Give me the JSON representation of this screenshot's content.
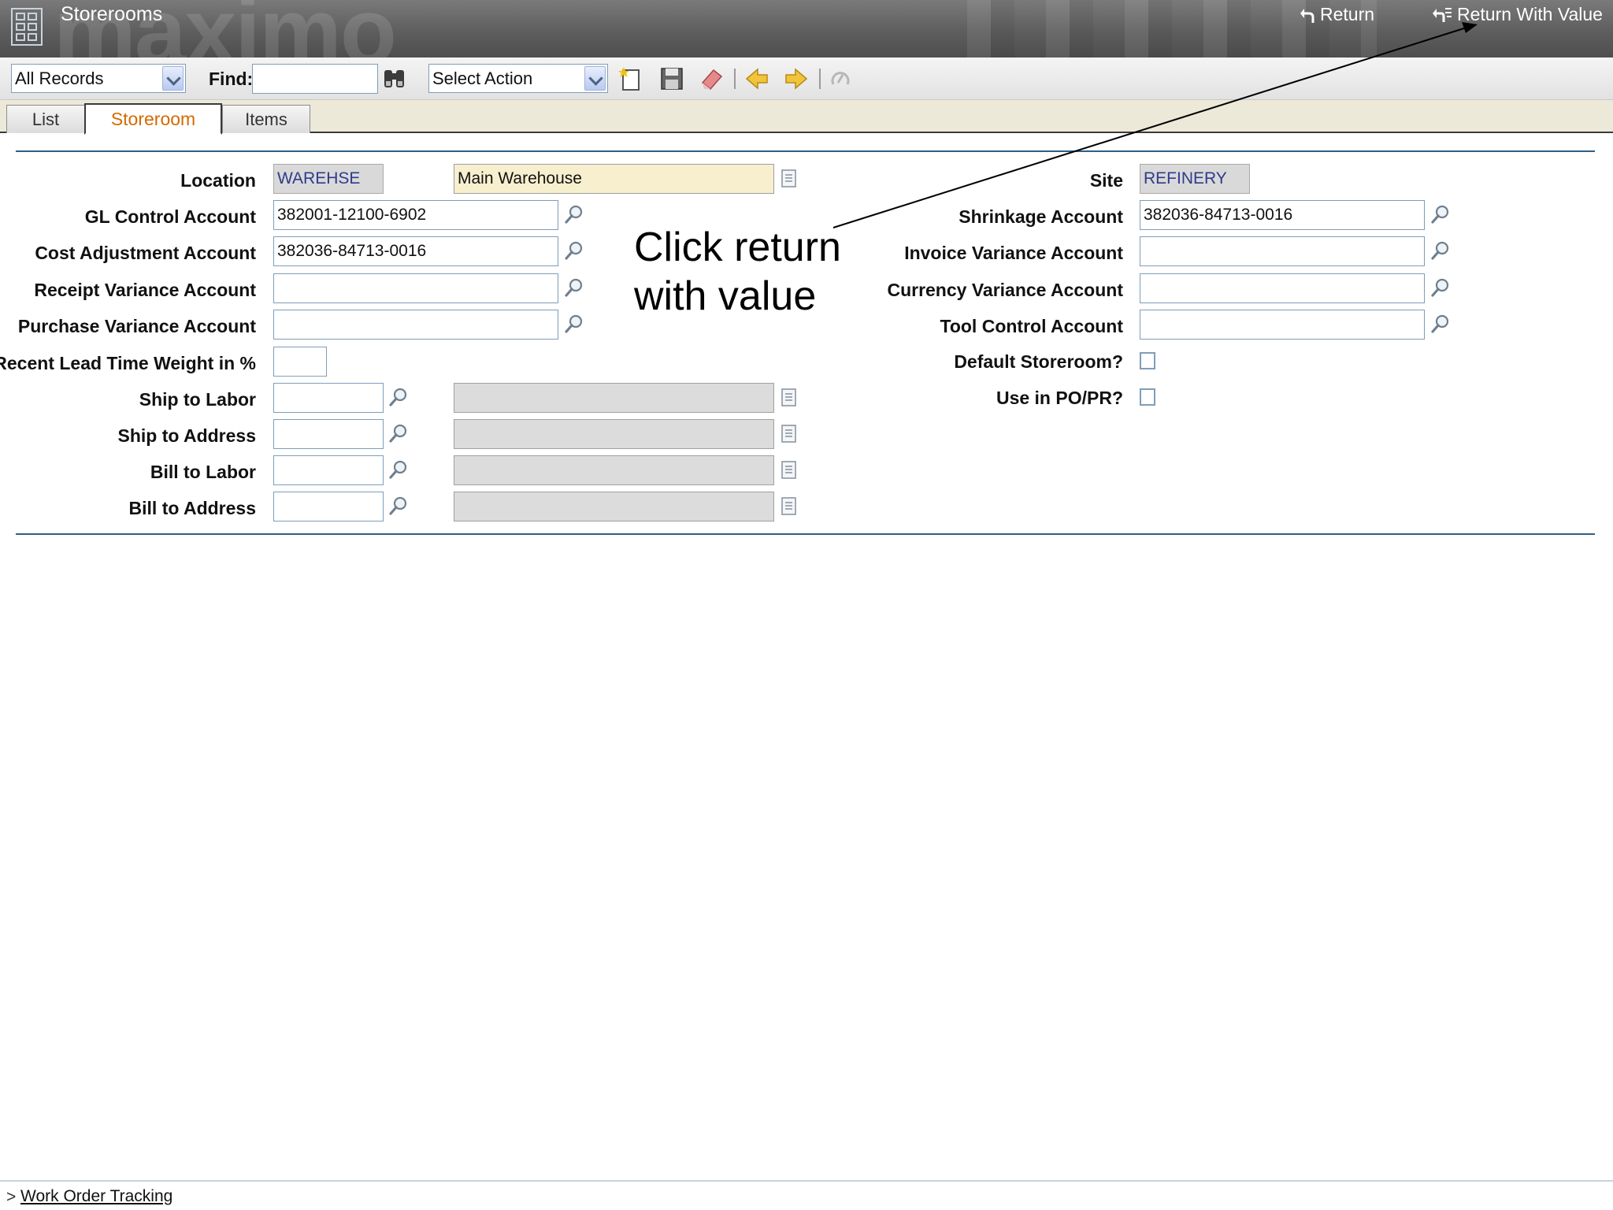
{
  "header": {
    "app_title": "Storerooms",
    "watermark": "maximo",
    "return_label": "Return",
    "return_with_value_label": "Return With Value"
  },
  "toolbar": {
    "query_select": "All Records",
    "find_label": "Find:",
    "find_value": "",
    "action_select": "Select Action"
  },
  "tabs": [
    {
      "label": "List"
    },
    {
      "label": "Storeroom"
    },
    {
      "label": "Items"
    }
  ],
  "form": {
    "location": {
      "label": "Location",
      "value": "WAREHSE",
      "description": "Main Warehouse"
    },
    "gl_control": {
      "label": "GL Control Account",
      "value": "382001-12100-6902"
    },
    "cost_adjustment": {
      "label": "Cost Adjustment Account",
      "value": "382036-84713-0016"
    },
    "receipt_variance": {
      "label": "Receipt Variance Account",
      "value": ""
    },
    "purchase_variance": {
      "label": "Purchase Variance Account",
      "value": ""
    },
    "lead_time_weight": {
      "label": "Recent Lead Time Weight in %",
      "value": ""
    },
    "ship_to_labor": {
      "label": "Ship to Labor",
      "value": "",
      "description": ""
    },
    "ship_to_address": {
      "label": "Ship to Address",
      "value": "",
      "description": ""
    },
    "bill_to_labor": {
      "label": "Bill to Labor",
      "value": "",
      "description": ""
    },
    "bill_to_address": {
      "label": "Bill to Address",
      "value": "",
      "description": ""
    },
    "site": {
      "label": "Site",
      "value": "REFINERY"
    },
    "shrinkage": {
      "label": "Shrinkage Account",
      "value": "382036-84713-0016"
    },
    "invoice_variance": {
      "label": "Invoice Variance Account",
      "value": ""
    },
    "currency_variance": {
      "label": "Currency Variance Account",
      "value": ""
    },
    "tool_control": {
      "label": "Tool Control Account",
      "value": ""
    },
    "default_storeroom": {
      "label": "Default Storeroom?",
      "checked": false
    },
    "use_in_popr": {
      "label": "Use in PO/PR?",
      "checked": false
    }
  },
  "annotation": {
    "line1": "Click return",
    "line2": "with value"
  },
  "footer": {
    "chevron": ">",
    "link": "Work Order Tracking"
  }
}
